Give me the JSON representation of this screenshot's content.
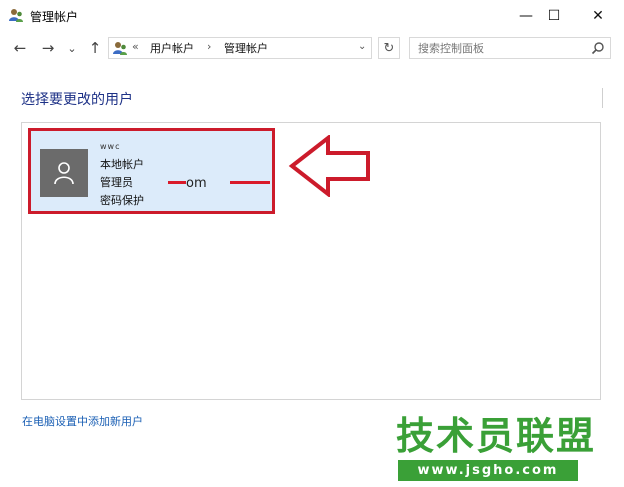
{
  "window": {
    "title": "管理帐户",
    "minimize_glyph": "—",
    "maximize_glyph": "☐",
    "close_glyph": "✕"
  },
  "nav": {
    "back_glyph": "←",
    "forward_glyph": "→",
    "recent_glyph": "⌄",
    "up_glyph": "↑",
    "address_prefix": "«",
    "breadcrumbs": [
      "用户帐户",
      "管理帐户"
    ],
    "breadcrumb_separator": "›",
    "dropdown_glyph": "⌄",
    "refresh_glyph": "↻",
    "search_placeholder": "搜索控制面板"
  },
  "main": {
    "heading": "选择要更改的用户",
    "account": {
      "name": "ᴡᴡᴄ",
      "lines": [
        "本地帐户",
        "管理员",
        "密码保护"
      ],
      "email_fragment": "om"
    },
    "add_user_link": "在电脑设置中添加新用户"
  },
  "watermark": {
    "title": "技术员联盟",
    "url": "www.jsgho.com"
  },
  "colors": {
    "accent_heading": "#1e3287",
    "tile_bg": "#dcebfa",
    "highlight_red": "#cc1b2b",
    "watermark_green": "#3aa037",
    "link": "#1a5fb4"
  }
}
